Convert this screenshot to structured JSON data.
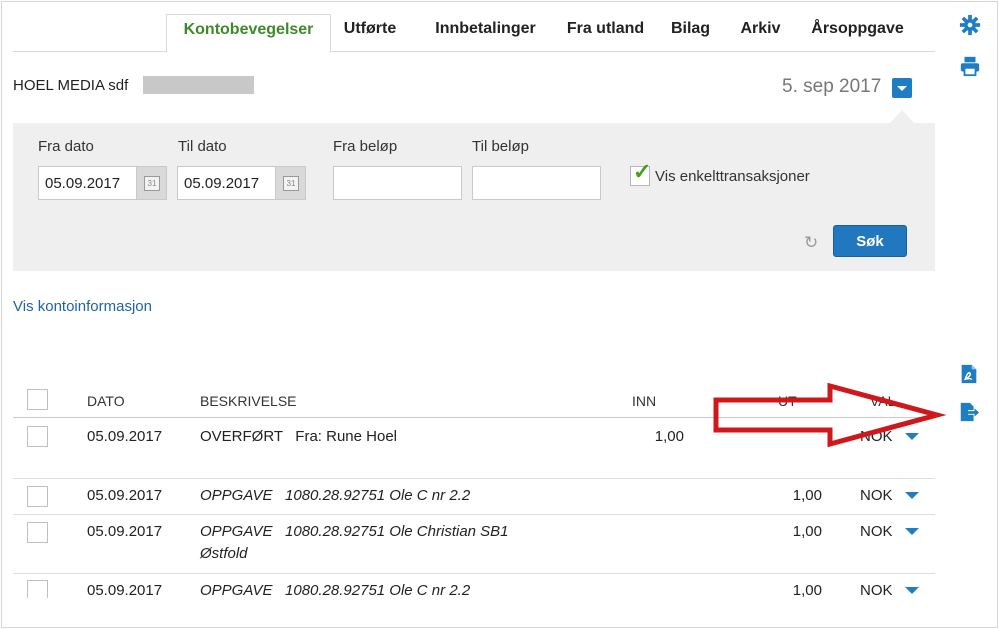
{
  "tabs": [
    {
      "label": "Kontobevegelser",
      "active": true
    },
    {
      "label": "Utførte"
    },
    {
      "label": "Innbetalinger"
    },
    {
      "label": "Fra utland"
    },
    {
      "label": "Bilag"
    },
    {
      "label": "Arkiv"
    },
    {
      "label": "Årsoppgave"
    }
  ],
  "account": {
    "name": "HOEL MEDIA sdf",
    "date": "5. sep 2017"
  },
  "filter": {
    "fra_dato_label": "Fra dato",
    "til_dato_label": "Til dato",
    "fra_belop_label": "Fra beløp",
    "til_belop_label": "Til beløp",
    "fra_dato_value": "05.09.2017",
    "til_dato_value": "05.09.2017",
    "fra_belop_value": "",
    "til_belop_value": "",
    "calendar_text": "31",
    "vis_enkelt_label": "Vis enkelttransaksjoner",
    "vis_enkelt_checked": true,
    "sok_label": "Søk"
  },
  "links": {
    "vis_kontoinfo": "Vis kontoinformasjon"
  },
  "table": {
    "headers": {
      "dato": "DATO",
      "beskrivelse": "BESKRIVELSE",
      "inn": "INN",
      "ut": "UT",
      "val": "VAL"
    },
    "rows": [
      {
        "dato": "05.09.2017",
        "beskrivelse": "OVERFØRT   Fra: Rune Hoel",
        "inn": "1,00",
        "ut": "",
        "val": "NOK"
      },
      {
        "dato": "05.09.2017",
        "beskrivelse": "OPPGAVE   1080.28.92751 Ole C nr 2.2",
        "inn": "",
        "ut": "1,00",
        "val": "NOK"
      },
      {
        "dato": "05.09.2017",
        "beskrivelse": "OPPGAVE   1080.28.92751 Ole Christian SB1 Østfold",
        "inn": "",
        "ut": "1,00",
        "val": "NOK"
      },
      {
        "dato": "05.09.2017",
        "beskrivelse": "OPPGAVE   1080.28.92751 Ole C nr 2.2",
        "inn": "",
        "ut": "1,00",
        "val": "NOK"
      }
    ]
  },
  "icons": {
    "settings": "gear-icon",
    "print": "printer-icon",
    "pdf_export": "pdf-export-icon",
    "file_export": "file-export-icon"
  },
  "colors": {
    "active_tab": "#3e8a2a",
    "primary": "#2278bf",
    "annotation_arrow": "#d0171c"
  }
}
